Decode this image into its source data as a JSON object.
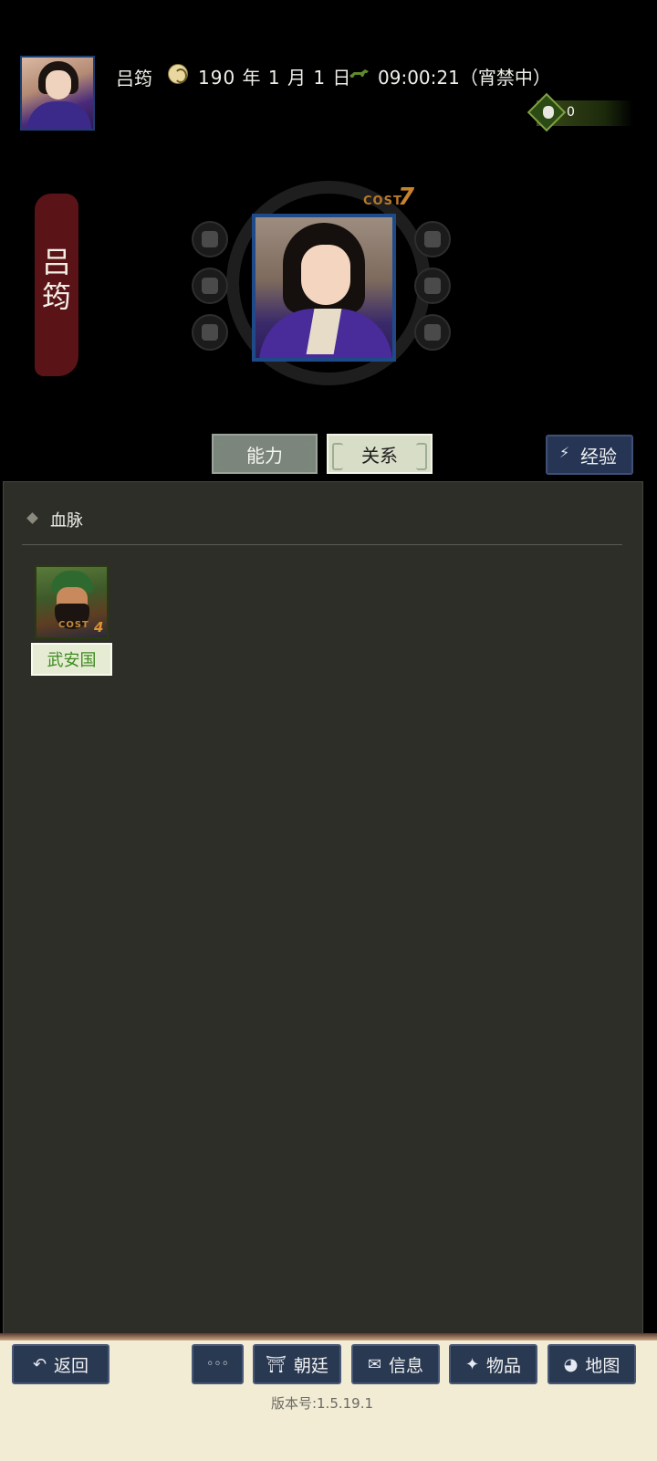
{
  "header": {
    "name": "吕筠",
    "date": "190 年 1 月 1 日",
    "time": "09:00:21（宵禁中）",
    "currency_value": "0"
  },
  "profile": {
    "banner_name": "吕\n筠",
    "cost_label": "COST",
    "cost_value": "7"
  },
  "tabs": {
    "ability": "能力",
    "relation": "关系",
    "experience": "经验"
  },
  "section": {
    "title": "血脉",
    "members": [
      {
        "name": "武安国",
        "cost_label": "COST",
        "cost_value": "4"
      }
    ]
  },
  "bottom_nav": {
    "back": "返回",
    "more": "◦◦◦",
    "court": "朝廷",
    "info": "信息",
    "items": "物品",
    "map": "地图",
    "version": "版本号:1.5.19.1"
  },
  "colors": {
    "background": "#000000",
    "panel": "#2e2e29",
    "banner": "#5a1418",
    "cost": "#c7822d",
    "button": "#2a3952",
    "bottom": "#f3ecd4"
  },
  "icons": {
    "left_column": [
      "crown-icon",
      "helmet-icon",
      "mask-icon"
    ],
    "right_column": [
      "hand-icon",
      "hat-icon",
      "graduation-cap-icon"
    ]
  }
}
